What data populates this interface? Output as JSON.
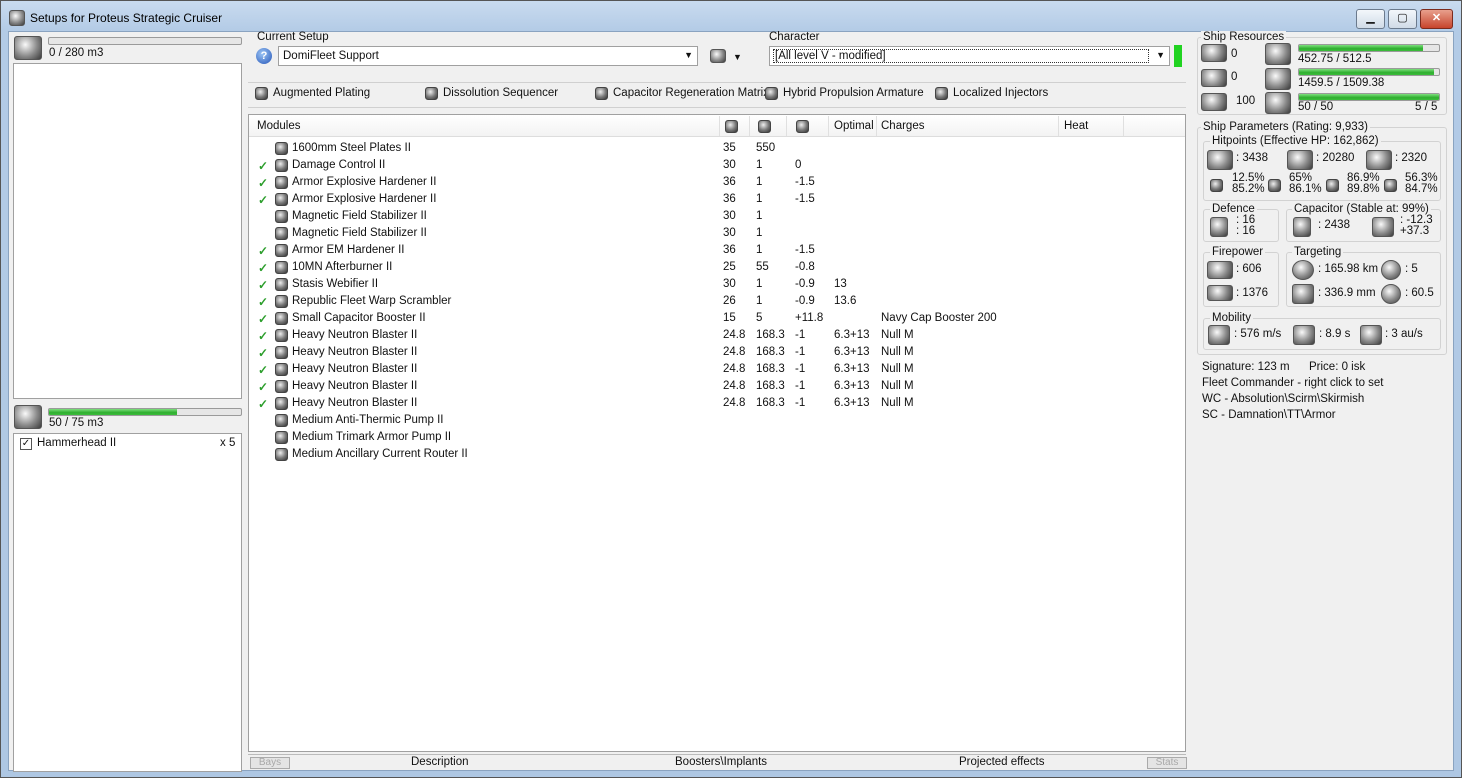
{
  "window": {
    "title": "Setups for Proteus Strategic Cruiser",
    "min": "▁",
    "max": "▢",
    "close": "✕"
  },
  "cargo": {
    "value": "0 / 280 m3",
    "fill": 0
  },
  "drones": {
    "bay": "50 / 75 m3",
    "fill": 0.667,
    "items": [
      {
        "name": "Hammerhead II",
        "qty": "x 5",
        "checked": true
      }
    ]
  },
  "setup": {
    "label": "Current Setup",
    "value": "DomiFleet Support",
    "help": "?"
  },
  "character": {
    "label": "Character",
    "value": "[All level V - modified]"
  },
  "subsystems": [
    "Augmented Plating",
    "Dissolution Sequencer",
    "Capacitor Regeneration Matrix",
    "Hybrid Propulsion Armature",
    "Localized Injectors"
  ],
  "modules": {
    "headers": {
      "name": "Modules",
      "optimal": "Optimal",
      "charges": "Charges",
      "heat": "Heat"
    },
    "rows": [
      {
        "check": "",
        "name": "1600mm Steel Plates II",
        "cpu": "35",
        "pg": "550",
        "cap": "",
        "opt": "",
        "charge": ""
      },
      {
        "check": "✓",
        "name": "Damage Control II",
        "cpu": "30",
        "pg": "1",
        "cap": "0",
        "opt": "",
        "charge": ""
      },
      {
        "check": "✓",
        "name": "Armor Explosive Hardener II",
        "cpu": "36",
        "pg": "1",
        "cap": "-1.5",
        "opt": "",
        "charge": ""
      },
      {
        "check": "✓",
        "name": "Armor Explosive Hardener II",
        "cpu": "36",
        "pg": "1",
        "cap": "-1.5",
        "opt": "",
        "charge": ""
      },
      {
        "check": "",
        "name": "Magnetic Field Stabilizer II",
        "cpu": "30",
        "pg": "1",
        "cap": "",
        "opt": "",
        "charge": ""
      },
      {
        "check": "",
        "name": "Magnetic Field Stabilizer II",
        "cpu": "30",
        "pg": "1",
        "cap": "",
        "opt": "",
        "charge": ""
      },
      {
        "check": "✓",
        "name": "Armor EM Hardener II",
        "cpu": "36",
        "pg": "1",
        "cap": "-1.5",
        "opt": "",
        "charge": ""
      },
      {
        "check": "✓",
        "name": "10MN Afterburner II",
        "cpu": "25",
        "pg": "55",
        "cap": "-0.8",
        "opt": "",
        "charge": ""
      },
      {
        "check": "✓",
        "name": "Stasis Webifier II",
        "cpu": "30",
        "pg": "1",
        "cap": "-0.9",
        "opt": "13",
        "charge": ""
      },
      {
        "check": "✓",
        "name": "Republic Fleet Warp Scrambler",
        "cpu": "26",
        "pg": "1",
        "cap": "-0.9",
        "opt": "13.6",
        "charge": ""
      },
      {
        "check": "✓",
        "name": "Small Capacitor Booster II",
        "cpu": "15",
        "pg": "5",
        "cap": "+11.8",
        "opt": "",
        "charge": "Navy Cap Booster 200"
      },
      {
        "check": "✓",
        "name": "Heavy Neutron Blaster II",
        "cpu": "24.8",
        "pg": "168.3",
        "cap": "-1",
        "opt": "6.3+13",
        "charge": "Null M"
      },
      {
        "check": "✓",
        "name": "Heavy Neutron Blaster II",
        "cpu": "24.8",
        "pg": "168.3",
        "cap": "-1",
        "opt": "6.3+13",
        "charge": "Null M"
      },
      {
        "check": "✓",
        "name": "Heavy Neutron Blaster II",
        "cpu": "24.8",
        "pg": "168.3",
        "cap": "-1",
        "opt": "6.3+13",
        "charge": "Null M"
      },
      {
        "check": "✓",
        "name": "Heavy Neutron Blaster II",
        "cpu": "24.8",
        "pg": "168.3",
        "cap": "-1",
        "opt": "6.3+13",
        "charge": "Null M"
      },
      {
        "check": "✓",
        "name": "Heavy Neutron Blaster II",
        "cpu": "24.8",
        "pg": "168.3",
        "cap": "-1",
        "opt": "6.3+13",
        "charge": "Null M"
      },
      {
        "check": "",
        "name": "Medium Anti-Thermic Pump II",
        "cpu": "",
        "pg": "",
        "cap": "",
        "opt": "",
        "charge": ""
      },
      {
        "check": "",
        "name": "Medium Trimark Armor Pump II",
        "cpu": "",
        "pg": "",
        "cap": "",
        "opt": "",
        "charge": ""
      },
      {
        "check": "",
        "name": "Medium Ancillary Current Router II",
        "cpu": "",
        "pg": "",
        "cap": "",
        "opt": "",
        "charge": ""
      }
    ]
  },
  "bottom_tabs": {
    "bays": "Bays",
    "description": "Description",
    "boosters": "Boosters\\Implants",
    "projected": "Projected effects",
    "stats": "Stats"
  },
  "resources": {
    "title": "Ship Resources",
    "turrets": "0",
    "launchers": "0",
    "calibration": "100",
    "cpu": {
      "value": "452.75 / 512.5",
      "fill": 0.883
    },
    "power": {
      "value": "1459.5 / 1509.38",
      "fill": 0.967
    },
    "drone_bw": {
      "value": "50 / 50",
      "fill": 1.0,
      "drones": "5 / 5"
    }
  },
  "params": {
    "title": "Ship Parameters (Rating: 9,933)",
    "hitpoints": {
      "title": "Hitpoints (Effective HP: 162,862)",
      "shield": ": 3438",
      "armor": ": 20280",
      "hull": ": 2320",
      "res": [
        [
          "12.5%",
          "85.2%"
        ],
        [
          "65%",
          "86.1%"
        ],
        [
          "86.9%",
          "89.8%"
        ],
        [
          "56.3%",
          "84.7%"
        ]
      ]
    },
    "defence": {
      "title": "Defence",
      "a": ": 16",
      "b": ": 16"
    },
    "capacitor": {
      "title": "Capacitor (Stable at: 99%)",
      "amount": ": 2438",
      "rate1": ": -12.3",
      "rate2": "+37.3"
    },
    "firepower": {
      "title": "Firepower",
      "dps": ": 606",
      "volley": ": 1376"
    },
    "targeting": {
      "title": "Targeting",
      "range": ": 165.98 km",
      "targets": ": 5",
      "res": ": 336.9 mm",
      "scan": ": 60.5"
    },
    "mobility": {
      "title": "Mobility",
      "speed": ": 576 m/s",
      "align": ": 8.9 s",
      "warp": ": 3 au/s"
    },
    "signature": "Signature: 123 m",
    "price": "Price: 0 isk",
    "fleet": "Fleet Commander - right click to set",
    "wc": "WC - Absolution\\Scirm\\Skirmish",
    "sc": "SC - Damnation\\TT\\Armor"
  },
  "colors": {
    "accent_green": "#2fae2f",
    "window_blue": "#b9d1ea"
  }
}
